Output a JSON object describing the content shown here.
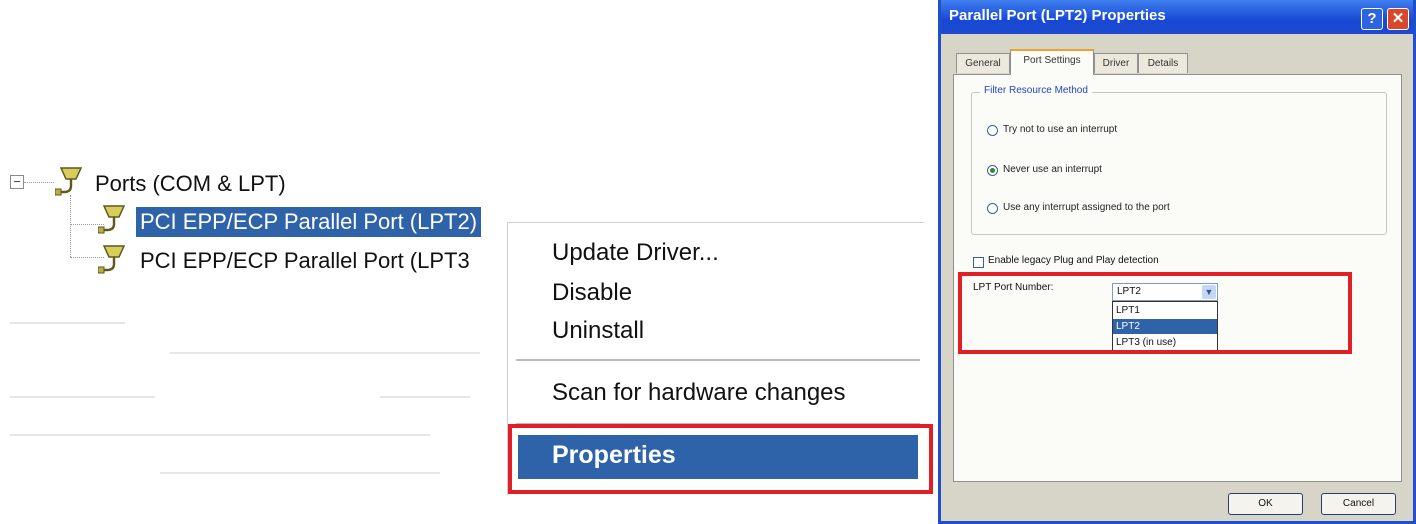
{
  "device_tree": {
    "category": "Ports (COM & LPT)",
    "expander": "−",
    "items": [
      "PCI EPP/ECP Parallel Port (LPT2)",
      "PCI EPP/ECP Parallel Port (LPT3"
    ],
    "selected_index": 0
  },
  "context_menu": {
    "items": [
      "Update Driver...",
      "Disable",
      "Uninstall",
      "Scan for hardware changes",
      "Properties"
    ],
    "highlighted": "Properties"
  },
  "dialog": {
    "title": "Parallel Port (LPT2) Properties",
    "help_glyph": "?",
    "close_glyph": "✕",
    "tabs": [
      "General",
      "Port Settings",
      "Driver",
      "Details"
    ],
    "active_tab": "Port Settings",
    "filter_group": {
      "title": "Filter Resource Method",
      "options": [
        "Try not to use an interrupt",
        "Never use an interrupt",
        "Use any interrupt assigned to the port"
      ],
      "selected_index": 1
    },
    "legacy_pnp_label": "Enable legacy Plug and Play detection",
    "legacy_pnp_checked": false,
    "lpt_port_label": "LPT Port Number:",
    "lpt_port_value": "LPT2",
    "lpt_options": [
      "LPT1",
      "LPT2",
      "LPT3 (in use)"
    ],
    "lpt_highlighted_index": 1,
    "ok_label": "OK",
    "cancel_label": "Cancel"
  },
  "colors": {
    "selection": "#2e62a9",
    "highlight_box": "#e01f26",
    "titlebar": "#1848d4",
    "dialog_bg": "#d7d4c8"
  }
}
